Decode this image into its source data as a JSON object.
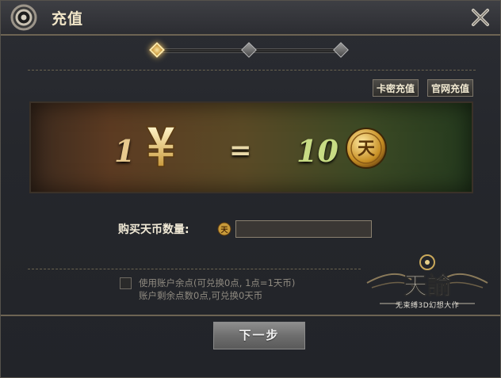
{
  "window": {
    "title": "充值"
  },
  "stepper": {
    "steps": [
      "step-1",
      "step-2",
      "step-3"
    ],
    "active_step": 1
  },
  "top_buttons": {
    "card_recharge": "卡密充值",
    "official_recharge": "官网充值"
  },
  "rate": {
    "rmb_amount": "1",
    "equals": "=",
    "coin_amount": "10",
    "currency_icon": "yen-icon",
    "coin_icon": "tian-coin-icon",
    "coin_char": "天"
  },
  "purchase": {
    "label": "购买天币数量:",
    "quantity_value": "",
    "coin_char": "天"
  },
  "balance": {
    "checkbox_label": "使用账户余点(可兑换0点, 1点=1天币)",
    "remaining_text": "账户剩余点数0点,可兑换0天币",
    "checked": false
  },
  "logo": {
    "title": "天諭",
    "subtitle": "无束缚3D幻想大作"
  },
  "footer": {
    "next_label": "下一步"
  },
  "colors": {
    "accent_gold": "#e7c98e",
    "frame_border": "#6d6453",
    "panel_green": "#3d4a25"
  }
}
